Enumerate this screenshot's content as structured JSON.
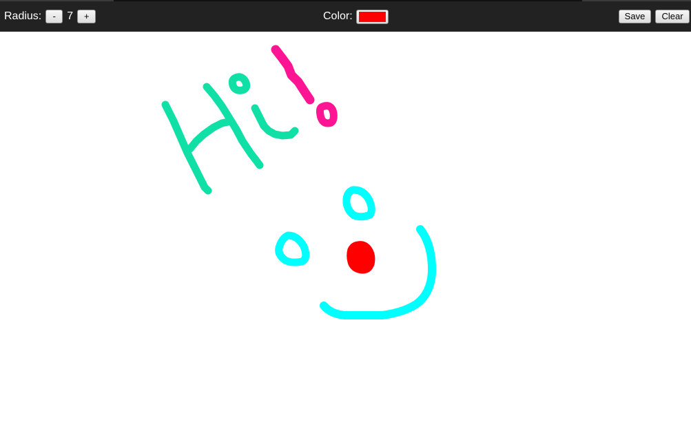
{
  "toolbar": {
    "radius_label": "Radius:",
    "radius_minus": "-",
    "radius_value": "7",
    "radius_plus": "+",
    "color_label": "Color:",
    "color_value": "#ff0000",
    "save_label": "Save",
    "clear_label": "Clear"
  },
  "drawing": {
    "strokes": [
      {
        "name": "hi-h-left-stroke",
        "color": "#10e0a6"
      },
      {
        "name": "hi-h-crossbar-stroke",
        "color": "#10e0a6"
      },
      {
        "name": "hi-h-right-stroke",
        "color": "#10e0a6"
      },
      {
        "name": "hi-i-body-stroke",
        "color": "#10e0a6"
      },
      {
        "name": "hi-i-dot-stroke",
        "color": "#10e0a6"
      },
      {
        "name": "exclamation-bar-stroke",
        "color": "#ff1493"
      },
      {
        "name": "exclamation-dot-stroke",
        "color": "#ff1493"
      },
      {
        "name": "left-eye-stroke",
        "color": "#00ffff"
      },
      {
        "name": "right-eye-stroke",
        "color": "#00ffff"
      },
      {
        "name": "nose-dot",
        "color": "#ff0000"
      },
      {
        "name": "smile-stroke",
        "color": "#00ffff"
      }
    ]
  }
}
